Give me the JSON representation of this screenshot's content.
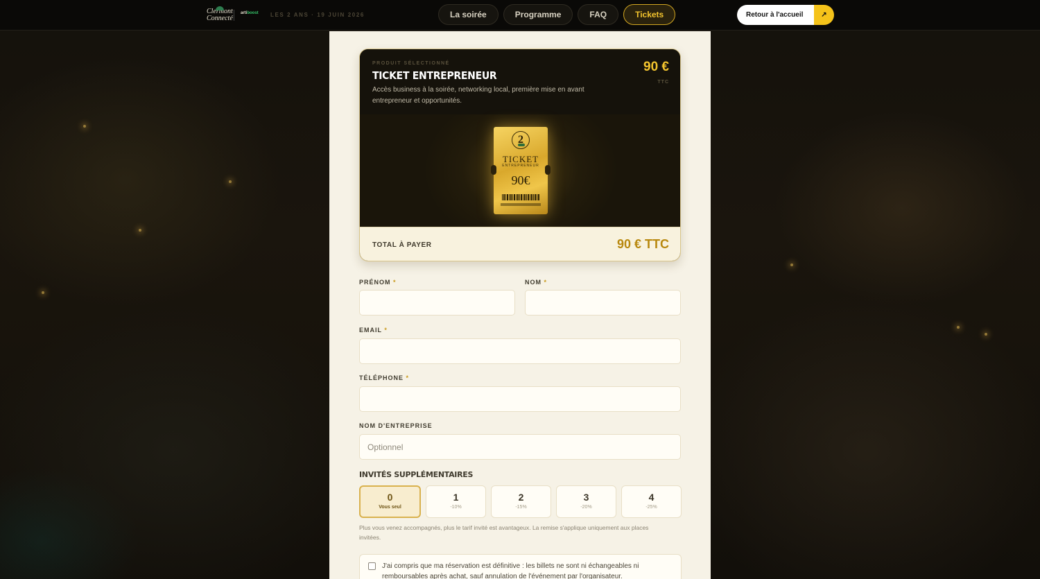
{
  "header": {
    "logo_primary": "Clermont Connecté",
    "logo_secondary_a": "arti",
    "logo_secondary_b": "boost",
    "event_info": "LES 2 ANS · 19 JUIN 2026",
    "nav": [
      {
        "label": "La soirée",
        "active": false
      },
      {
        "label": "Programme",
        "active": false
      },
      {
        "label": "FAQ",
        "active": false
      },
      {
        "label": "Tickets",
        "active": true
      }
    ],
    "back_label": "Retour à l'accueil",
    "back_icon": "arrow-up-right-icon"
  },
  "product": {
    "kicker": "PRODUIT SÉLECTIONNÉ",
    "title": "TICKET ENTREPRENEUR",
    "description": "Accès business à la soirée, networking local, première mise en avant entrepreneur et opportunités.",
    "price": "90 €",
    "price_note": "TTC",
    "ticket_image": {
      "emblem": "2",
      "word": "TICKET",
      "sub": "ENTREPRENEUR",
      "price": "90€"
    },
    "total_label": "TOTAL À PAYER",
    "total_value": "90 € TTC"
  },
  "form": {
    "prenom_label": "PRÉNOM",
    "nom_label": "NOM",
    "email_label": "EMAIL",
    "telephone_label": "TÉLÉPHONE",
    "entreprise_label": "NOM D'ENTREPRISE",
    "required_mark": "*",
    "prenom_value": "",
    "nom_value": "",
    "email_value": "",
    "telephone_value": "",
    "entreprise_placeholder": "Optionnel"
  },
  "guests": {
    "title": "INVITÉS SUPPLÉMENTAIRES",
    "options": [
      {
        "count": "0",
        "label": "Vous seul",
        "selected": true
      },
      {
        "count": "1",
        "label": "-10%",
        "selected": false
      },
      {
        "count": "2",
        "label": "-15%",
        "selected": false
      },
      {
        "count": "3",
        "label": "-20%",
        "selected": false
      },
      {
        "count": "4",
        "label": "-25%",
        "selected": false
      }
    ],
    "note": "Plus vous venez accompagnés, plus le tarif invité est avantageux. La remise s'applique uniquement aux places invitées."
  },
  "consent": {
    "checked": false,
    "text": "J'ai compris que ma réservation est définitive : les billets ne sont ni échangeables ni remboursables après achat, sauf annulation de l'événement par l'organisateur."
  },
  "colors": {
    "accent_gold": "#f3c42e",
    "total_gold": "#b8880e",
    "panel_bg": "#f6f2e6",
    "page_bg": "#0b0906"
  }
}
